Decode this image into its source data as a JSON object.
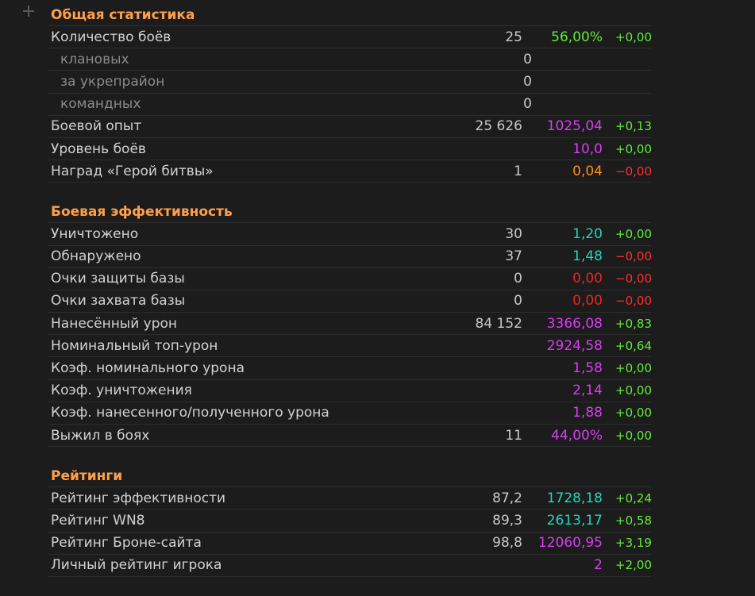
{
  "general": {
    "title": "Общая статистика",
    "rows": [
      {
        "label": "Количество боёв",
        "count": "25",
        "value": "56,00%",
        "value_color": "green",
        "delta": "+0,00",
        "delta_sign": "pos",
        "sub": false
      },
      {
        "label": "клановых",
        "count": "0",
        "value": "",
        "value_color": "",
        "delta": "",
        "delta_sign": "",
        "sub": true
      },
      {
        "label": "за укрепрайон",
        "count": "0",
        "value": "",
        "value_color": "",
        "delta": "",
        "delta_sign": "",
        "sub": true
      },
      {
        "label": "командных",
        "count": "0",
        "value": "",
        "value_color": "",
        "delta": "",
        "delta_sign": "",
        "sub": true
      },
      {
        "label": "Боевой опыт",
        "count": "25 626",
        "value": "1025,04",
        "value_color": "magenta",
        "delta": "+0,13",
        "delta_sign": "pos",
        "sub": false
      },
      {
        "label": "Уровень боёв",
        "count": "",
        "value": "10,0",
        "value_color": "magenta",
        "delta": "+0,00",
        "delta_sign": "pos",
        "sub": false
      },
      {
        "label": "Наград «Герой битвы»",
        "count": "1",
        "value": "0,04",
        "value_color": "orange",
        "delta": "−0,00",
        "delta_sign": "neg",
        "sub": false
      }
    ]
  },
  "efficiency": {
    "title": "Боевая эффективность",
    "rows": [
      {
        "label": "Уничтожено",
        "count": "30",
        "value": "1,20",
        "value_color": "teal",
        "delta": "+0,00",
        "delta_sign": "pos",
        "sub": false
      },
      {
        "label": "Обнаружено",
        "count": "37",
        "value": "1,48",
        "value_color": "teal",
        "delta": "−0,00",
        "delta_sign": "neg",
        "sub": false
      },
      {
        "label": "Очки защиты базы",
        "count": "0",
        "value": "0,00",
        "value_color": "red",
        "delta": "−0,00",
        "delta_sign": "neg",
        "sub": false
      },
      {
        "label": "Очки захвата базы",
        "count": "0",
        "value": "0,00",
        "value_color": "red",
        "delta": "−0,00",
        "delta_sign": "neg",
        "sub": false
      },
      {
        "label": "Нанесённый урон",
        "count": "84 152",
        "value": "3366,08",
        "value_color": "magenta",
        "delta": "+0,83",
        "delta_sign": "pos",
        "sub": false
      },
      {
        "label": "Номинальный топ-урон",
        "count": "",
        "value": "2924,58",
        "value_color": "magenta",
        "delta": "+0,64",
        "delta_sign": "pos",
        "sub": false
      },
      {
        "label": "Коэф. номинального урона",
        "count": "",
        "value": "1,58",
        "value_color": "magenta",
        "delta": "+0,00",
        "delta_sign": "pos",
        "sub": false
      },
      {
        "label": "Коэф. уничтожения",
        "count": "",
        "value": "2,14",
        "value_color": "magenta",
        "delta": "+0,00",
        "delta_sign": "pos",
        "sub": false
      },
      {
        "label": "Коэф. нанесенного/полученного урона",
        "count": "",
        "value": "1,88",
        "value_color": "magenta",
        "delta": "+0,00",
        "delta_sign": "pos",
        "sub": false
      },
      {
        "label": "Выжил в боях",
        "count": "11",
        "value": "44,00%",
        "value_color": "magenta",
        "delta": "+0,00",
        "delta_sign": "pos",
        "sub": false
      }
    ]
  },
  "ratings": {
    "title": "Рейтинги",
    "rows": [
      {
        "label": "Рейтинг эффективности",
        "count": "87,2",
        "value": "1728,18",
        "value_color": "teal",
        "delta": "+0,24",
        "delta_sign": "pos",
        "sub": false
      },
      {
        "label": "Рейтинг WN8",
        "count": "89,3",
        "value": "2613,17",
        "value_color": "teal",
        "delta": "+0,58",
        "delta_sign": "pos",
        "sub": false
      },
      {
        "label": "Рейтинг Броне-сайта",
        "count": "98,8",
        "value": "12060,95",
        "value_color": "magenta",
        "delta": "+3,19",
        "delta_sign": "pos",
        "sub": false
      },
      {
        "label": "Личный рейтинг игрока",
        "count": "",
        "value": "2",
        "value_color": "magenta",
        "delta": "+2,00",
        "delta_sign": "pos",
        "sub": false
      }
    ]
  },
  "colors": {
    "section_title": "#ff9f4a",
    "green": "#66e83a",
    "magenta": "#d93cf5",
    "orange": "#ff8c1a",
    "teal": "#22d6b6",
    "red": "#e8261e",
    "delta_pos": "#5fe83a",
    "delta_neg": "#ff2d2d"
  }
}
